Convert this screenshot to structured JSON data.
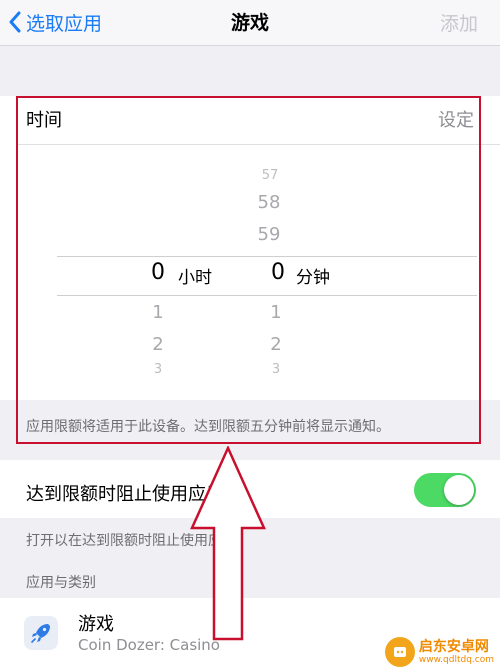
{
  "nav": {
    "back_label": "选取应用",
    "title": "游戏",
    "add_label": "添加"
  },
  "time_section": {
    "label": "时间",
    "action": "设定",
    "picker": {
      "hours_above": [
        "57",
        "58",
        "59"
      ],
      "hours_selected": "0",
      "hours_unit": "小时",
      "hours_below": [
        "1",
        "2",
        "3"
      ],
      "minutes_selected": "0",
      "minutes_unit": "分钟",
      "minutes_below": [
        "1",
        "2",
        "3"
      ]
    },
    "footnote": "应用限额将适用于此设备。达到限额五分钟前将显示通知。"
  },
  "block_toggle": {
    "label": "达到限额时阻止使用应用",
    "enabled": true,
    "footnote": "打开以在达到限额时阻止使用应用。"
  },
  "apps_section": {
    "header": "应用与类别",
    "app": {
      "name": "游戏",
      "subtitle": "Coin Dozer: Casino"
    }
  },
  "colors": {
    "accent": "#1a7cf4",
    "switch_on": "#4cd964",
    "highlight": "#c8102e"
  },
  "watermark": {
    "name": "启东安卓网",
    "url": "www.qdltdq.com"
  }
}
